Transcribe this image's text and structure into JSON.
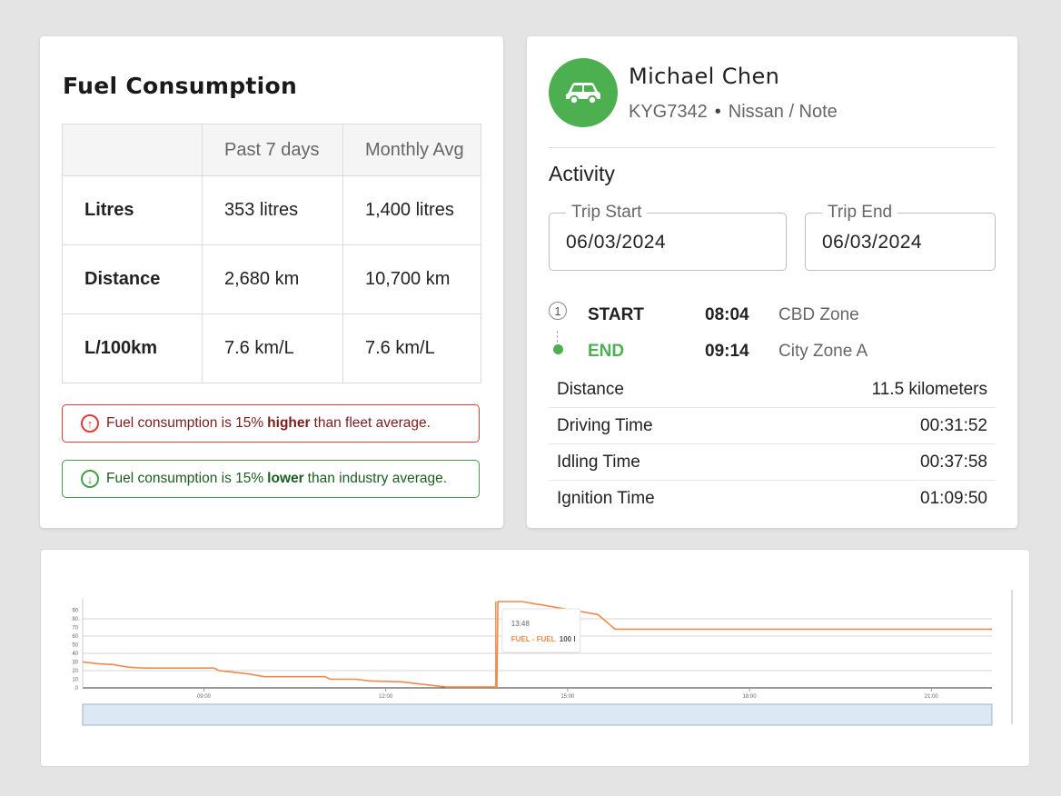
{
  "fuel": {
    "title": "Fuel Consumption",
    "columns": [
      "",
      "Past 7 days",
      "Monthly Avg"
    ],
    "rows": [
      {
        "label": "Litres",
        "past7": "353 litres",
        "monthly": "1,400 litres"
      },
      {
        "label": "Distance",
        "past7": "2,680 km",
        "monthly": "10,700 km"
      },
      {
        "label": "L/100km",
        "past7": "7.6 km/L",
        "monthly": "7.6 km/L"
      }
    ],
    "alerts": {
      "high": {
        "before": "Fuel consumption is 15%",
        "strong": "higher",
        "after": "than fleet average.",
        "color": "#e53935",
        "icon": "arrow-up-circle-icon"
      },
      "low": {
        "before": "Fuel consumption is 15%",
        "strong": "lower",
        "after": "than industry average.",
        "color": "#43a047",
        "icon": "arrow-down-circle-icon"
      }
    }
  },
  "driver": {
    "name": "Michael Chen",
    "plate": "KYG7342",
    "separator": "•",
    "vehicle": "Nissan / Note",
    "avatar_icon": "car-icon",
    "avatar_color": "#4caf50"
  },
  "activity": {
    "title": "Activity",
    "trip_start": {
      "label": "Trip Start",
      "value": "06/03/2024"
    },
    "trip_end": {
      "label": "Trip End",
      "value": "06/03/2024"
    },
    "timeline": [
      {
        "marker": "1",
        "type": "START",
        "time": "08:04",
        "zone": "CBD Zone"
      },
      {
        "marker": "",
        "type": "END",
        "time": "09:14",
        "zone": "City Zone A",
        "color": "#4caf50"
      }
    ],
    "stats": [
      {
        "label": "Distance",
        "value": "11.5 kilometers"
      },
      {
        "label": "Driving Time",
        "value": "00:31:52"
      },
      {
        "label": "Idling Time",
        "value": "00:37:58"
      },
      {
        "label": "Ignition Time",
        "value": "01:09:50"
      }
    ]
  },
  "chart_data": {
    "type": "line",
    "series": [
      {
        "color": "#f08a4b"
      }
    ],
    "ylim": [
      0,
      100
    ],
    "yticks": [
      "0",
      "10",
      "20",
      "30",
      "40",
      "50",
      "60",
      "70",
      "80",
      "90"
    ],
    "xlim": [
      "07:00",
      "22:00"
    ],
    "xticks": [
      "09:00",
      "12:00",
      "15:00",
      "18:00",
      "21:00"
    ],
    "points": [
      [
        "07:00",
        30
      ],
      [
        "07:15",
        28
      ],
      [
        "07:30",
        27
      ],
      [
        "07:45",
        24
      ],
      [
        "08:00",
        23
      ],
      [
        "09:10",
        23
      ],
      [
        "09:15",
        20
      ],
      [
        "09:45",
        16
      ],
      [
        "10:00",
        13
      ],
      [
        "11:00",
        13
      ],
      [
        "11:05",
        10
      ],
      [
        "11:30",
        10
      ],
      [
        "11:45",
        8
      ],
      [
        "12:15",
        7
      ],
      [
        "12:45",
        3
      ],
      [
        "13:00",
        1
      ],
      [
        "13:40",
        1
      ],
      [
        "13:50",
        1
      ],
      [
        "13:51",
        100
      ],
      [
        "14:15",
        100
      ],
      [
        "14:30",
        97
      ],
      [
        "14:35",
        96
      ],
      [
        "14:40",
        95
      ],
      [
        "15:15",
        88
      ],
      [
        "15:30",
        85
      ],
      [
        "15:35",
        80
      ],
      [
        "15:40",
        75
      ],
      [
        "15:45",
        70
      ],
      [
        "15:47",
        68
      ],
      [
        "22:00",
        68
      ]
    ],
    "marker_x": "13:48",
    "tooltip": {
      "time": "13:48",
      "series": "FUEL - FUEL",
      "value": "100 l"
    },
    "navigator_color": "#dce8f4",
    "grid": true
  }
}
